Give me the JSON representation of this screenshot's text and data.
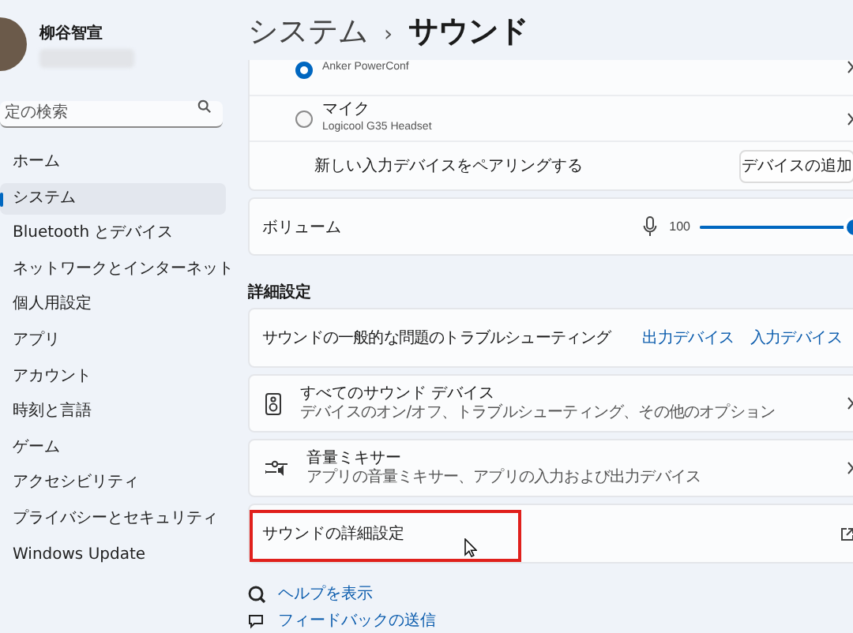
{
  "sidebar": {
    "user_name": "柳谷智宣",
    "search": {
      "placeholder": "定の検索"
    },
    "items": [
      {
        "label": "ホーム",
        "selected": false
      },
      {
        "label": "システム",
        "selected": true
      },
      {
        "label": "Bluetooth とデバイス",
        "selected": false
      },
      {
        "label": "ネットワークとインターネット",
        "selected": false
      },
      {
        "label": "個人用設定",
        "selected": false
      },
      {
        "label": "アプリ",
        "selected": false
      },
      {
        "label": "アカウント",
        "selected": false
      },
      {
        "label": "時刻と言語",
        "selected": false
      },
      {
        "label": "ゲーム",
        "selected": false
      },
      {
        "label": "アクセシビリティ",
        "selected": false
      },
      {
        "label": "プライバシーとセキュリティ",
        "selected": false
      },
      {
        "label": "Windows Update",
        "selected": false
      }
    ]
  },
  "breadcrumb": {
    "parent": "システム",
    "separator": "›",
    "current": "サウンド"
  },
  "input_devices": [
    {
      "subtitle": "Anker PowerConf",
      "selected": true
    },
    {
      "name": "マイク",
      "subtitle": "Logicool G35 Headset",
      "selected": false
    }
  ],
  "pair": {
    "label": "新しい入力デバイスをペアリングする",
    "button": "デバイスの追加"
  },
  "volume": {
    "label": "ボリューム",
    "reading": "100",
    "level": 1.0
  },
  "section_heading": "詳細設定",
  "troubleshoot": {
    "label": "サウンドの一般的な問題のトラブルシューティング",
    "links": [
      "出力デバイス",
      "入力デバイス"
    ]
  },
  "rows": [
    {
      "kind": "speaker",
      "title": "すべてのサウンド デバイス",
      "subtitle": "デバイスのオン/オフ、トラブルシューティング、その他のオプション"
    },
    {
      "kind": "mixer",
      "title": "音量ミキサー",
      "subtitle": "アプリの音量ミキサー、アプリの入力および出力デバイス"
    }
  ],
  "advanced": {
    "title": "サウンドの詳細設定",
    "highlighted": true
  },
  "footer_links": [
    {
      "kind": "help",
      "label": "ヘルプを表示"
    },
    {
      "kind": "feedback",
      "label": "フィードバックの送信"
    }
  ]
}
